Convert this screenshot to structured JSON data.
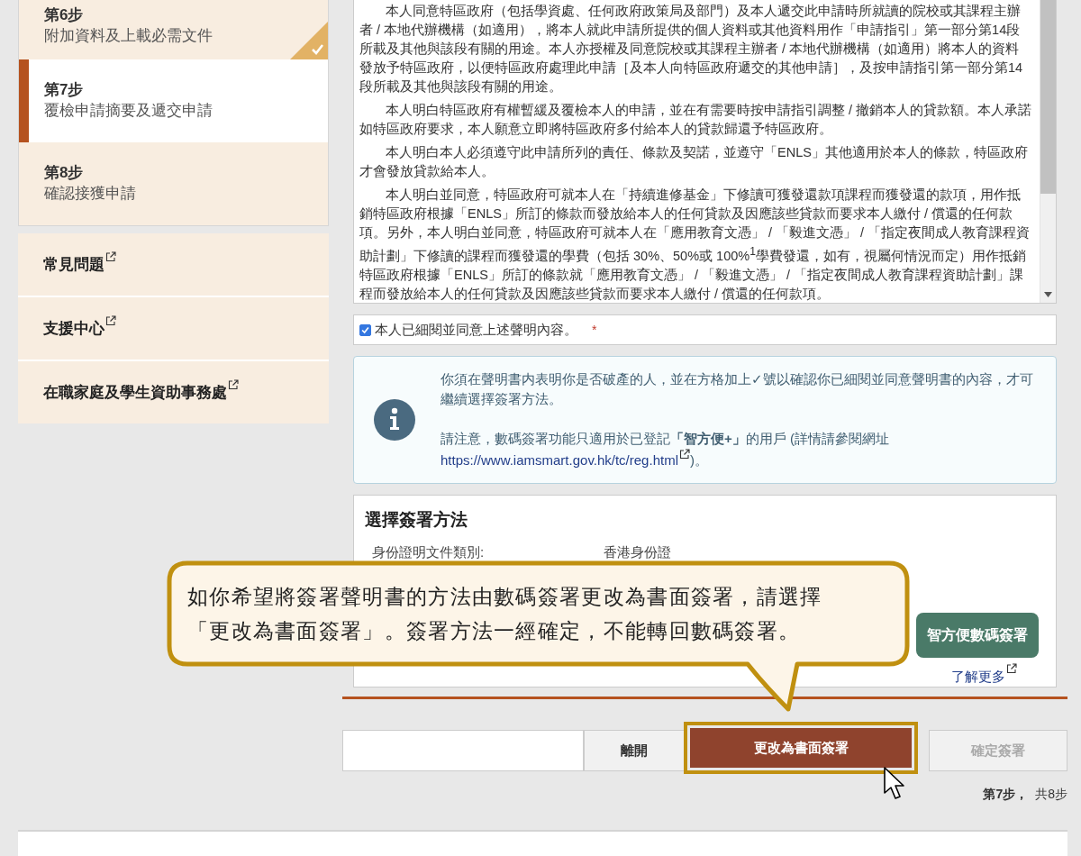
{
  "steps": [
    {
      "label": "第6步",
      "title": "附加資料及上載必需文件",
      "selected": false,
      "done": true
    },
    {
      "label": "第7步",
      "title": "覆檢申請摘要及遞交申請",
      "selected": true,
      "done": false
    },
    {
      "label": "第8步",
      "title": "確認接獲申請",
      "selected": false,
      "done": false
    }
  ],
  "links": [
    {
      "label": "常見問題"
    },
    {
      "label": "支援中心"
    },
    {
      "label": "在職家庭及學生資助事務處"
    }
  ],
  "declaration": {
    "paragraphs": [
      "本人同意特區政府（包括學資處、任何政府政策局及部門）及本人遞交此申請時所就讀的院校或其課程主辦者 / 本地代辦機構（如適用），將本人就此申請所提供的個人資料或其他資料用作「申請指引」第一部分第14段所載及其他與該段有關的用途。本人亦授權及同意院校或其課程主辦者 / 本地代辦機構（如適用）將本人的資料發放予特區政府，以便特區政府處理此申請［及本人向特區政府遞交的其他申請］，及按申請指引第一部分第14段所載及其他與該段有關的用途。",
      "本人明白特區政府有權暫緩及覆檢本人的申請，並在有需要時按申請指引調整 / 撤銷本人的貸款額。本人承諾如特區政府要求，本人願意立即將特區政府多付給本人的貸款歸還予特區政府。",
      "本人明白本人必須遵守此申請所列的責任、條款及契諾，並遵守「ENLS」其他適用於本人的條款，特區政府才會發放貸款給本人。",
      "本人明白並同意，特區政府可就本人在「持續進修基金」下修讀可獲發還款項課程而獲發還的款項，用作抵銷特區政府根據「ENLS」所訂的條款而發放給本人的任何貸款及因應該些貸款而要求本人繳付 / 償還的任何款項。另外，本人明白並同意，特區政府可就本人在「應用教育文憑」 / 「毅進文憑」 / 「指定夜間成人教育課程資助計劃」下修讀的課程而獲發還的學費（包括 30%、50%或 100%$^{1}$學費發還，如有，視屬何情況而定）用作抵銷特區政府根據「ENLS」所訂的條款就「應用教育文憑」 / 「毅進文憑」 / 「指定夜間成人教育課程資助計劃」課程而發放給本人的任何貸款及因應該些貸款而要求本人繳付 / 償還的任何款項。"
    ],
    "agree": {
      "label": "本人已細閱並同意上述聲明內容。",
      "checked": true,
      "required_mark": "*"
    }
  },
  "info": {
    "message": "你須在聲明書内表明你是否破產的人，並在方格加上✓號以確認你已細閱並同意聲明書的內容，才可繼續選擇簽署方法。",
    "note": "請注意，數碼簽署功能只適用於已登記**「智方便+」**的用戶 (詳情請參閱網址",
    "link": "https://www.iamsmart.gov.hk/tc/reg.html",
    "note_end": ")。"
  },
  "signing": {
    "title": "選擇簽署方法",
    "fields": [
      {
        "label": "身份證明文件類別:",
        "value": "香港身份證"
      }
    ],
    "digital_button": "智方便數碼簽署",
    "learn_more": "了解更多"
  },
  "nav": {
    "buttons": [
      {
        "label": "離開",
        "kind": "plain",
        "disabled": false,
        "highlighted": false
      },
      {
        "label": "更改為書面簽署",
        "kind": "primary",
        "disabled": false,
        "highlighted": true
      },
      {
        "label": "確定簽署",
        "kind": "plain",
        "disabled": true,
        "highlighted": false
      }
    ],
    "progress": {
      "current": "第7步，",
      "total": "共8步"
    }
  },
  "callout": {
    "lines": [
      "如你希望將簽署聲明書的方法由數碼簽署更改為書面簽署，請選擇",
      "「更改為書面簽署」。簽署方法一經確定，不能轉回數碼簽署。"
    ]
  }
}
